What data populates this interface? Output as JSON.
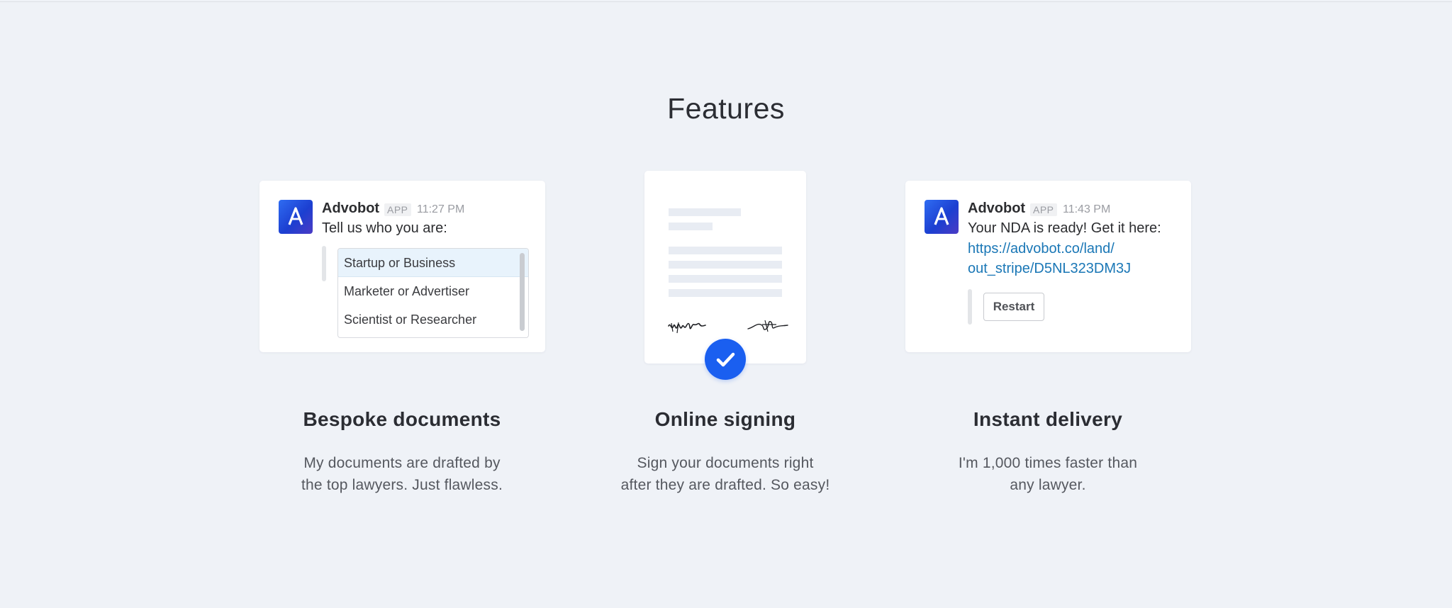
{
  "section": {
    "title": "Features"
  },
  "features": [
    {
      "title": "Bespoke documents",
      "desc_line1": "My documents are drafted by",
      "desc_line2": "the top lawyers. Just flawless."
    },
    {
      "title": "Online signing",
      "desc_line1": "Sign your documents right",
      "desc_line2": "after they are drafted. So easy!"
    },
    {
      "title": "Instant delivery",
      "desc_line1": "I'm 1,000 times faster than",
      "desc_line2": "any lawyer."
    }
  ],
  "card_chat_1": {
    "bot_name": "Advobot",
    "tag": "APP",
    "time": "11:27 PM",
    "message": "Tell us who you are:",
    "options": [
      "Startup or Business",
      "Marketer or Advertiser",
      "Scientist or Researcher"
    ],
    "selected_option": "Startup or Business"
  },
  "card_chat_2": {
    "bot_name": "Advobot",
    "tag": "APP",
    "time": "11:43 PM",
    "message": "Your NDA is ready! Get it here:",
    "link_line1": "https://advobot.co/land/",
    "link_line2": "out_stripe/D5NL323DM3J",
    "button_label": "Restart"
  },
  "card_doc": {
    "icons": [
      "signature-icon",
      "signature-icon",
      "checkmark-icon"
    ]
  },
  "colors": {
    "background": "#eff2f7",
    "accent": "#1a5ff0",
    "link": "#1a77b6"
  }
}
